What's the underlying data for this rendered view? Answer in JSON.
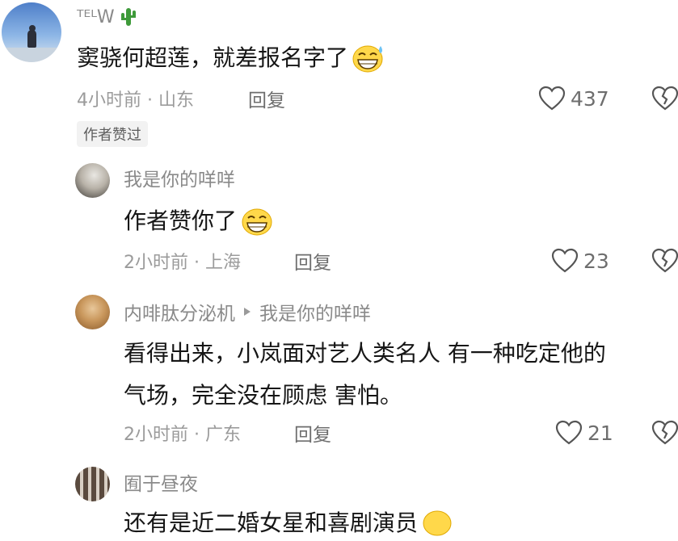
{
  "comments": [
    {
      "username": "ᵀᴱᴸW",
      "text": "窦骁何超莲，就差报名字了",
      "time_location": "4小时前 · 山东",
      "reply_label": "回复",
      "likes": "437",
      "badge": "作者赞过"
    },
    {
      "username": "我是你的咩咩",
      "text": "作者赞你了",
      "time_location": "2小时前 · 上海",
      "reply_label": "回复",
      "likes": "23"
    },
    {
      "username": "内啡肽分泌机",
      "reply_to": "我是你的咩咩",
      "text_line1": "看得出来，小岚面对艺人类名人 有一种吃定他的",
      "text_line2": "气场，完全没在顾虑 害怕。",
      "time_location": "2小时前 · 广东",
      "reply_label": "回复",
      "likes": "21"
    },
    {
      "username": "囿于昼夜",
      "text": "还有是近二婚女星和喜剧演员"
    }
  ],
  "icons": {
    "like": "heart-outline-icon",
    "dislike": "broken-heart-icon",
    "reply_arrow": "triangle-right-icon",
    "emoji": "grinning-sweat-emoji"
  },
  "colors": {
    "primary_text": "#161616",
    "secondary_text": "#8a8a8a",
    "meta_text": "#9b9b9b",
    "badge_bg": "#f2f2f2"
  }
}
